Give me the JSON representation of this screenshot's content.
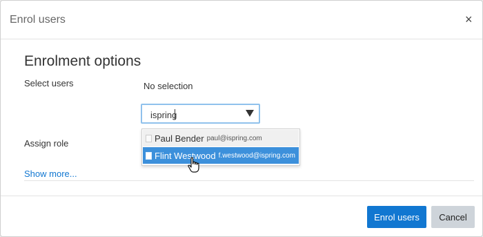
{
  "dialog": {
    "title": "Enrol users",
    "close_label": "×"
  },
  "form": {
    "section_title": "Enrolment options",
    "select_users_label": "Select users",
    "selection_text": "No selection",
    "search_value": "ispring",
    "assign_role_label": "Assign role",
    "show_more": "Show more..."
  },
  "suggestions": [
    {
      "name": "Paul Bender",
      "email": "paul@ispring.com",
      "highlighted": false
    },
    {
      "name": "Flint Westwood",
      "email": "f.westwood@ispring.com",
      "highlighted": true
    }
  ],
  "footer": {
    "primary_label": "Enrol users",
    "secondary_label": "Cancel"
  },
  "colors": {
    "accent": "#1177d1",
    "highlight": "#3c90db",
    "focus_border": "#8fc1ec"
  }
}
